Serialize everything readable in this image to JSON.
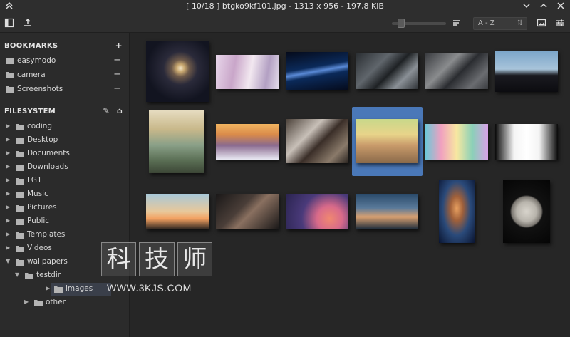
{
  "window": {
    "title": "[ 10/18 ] btgko9kf101.jpg - 1313 x 956 - 197,8 KiB"
  },
  "toolbar": {
    "sort_label": "A - Z",
    "sort_order_icon": "sort-az-icon"
  },
  "bookmarks": {
    "heading": "BOOKMARKS",
    "items": [
      {
        "label": "easymodo"
      },
      {
        "label": "camera"
      },
      {
        "label": "Screenshots"
      }
    ]
  },
  "filesystem": {
    "heading": "FILESYSTEM",
    "items": [
      {
        "label": "coding",
        "expanded": false
      },
      {
        "label": "Desktop",
        "expanded": false
      },
      {
        "label": "Documents",
        "expanded": false
      },
      {
        "label": "Downloads",
        "expanded": false
      },
      {
        "label": "LG1",
        "expanded": false
      },
      {
        "label": "Music",
        "expanded": false
      },
      {
        "label": "Pictures",
        "expanded": false
      },
      {
        "label": "Public",
        "expanded": false
      },
      {
        "label": "Templates",
        "expanded": false
      },
      {
        "label": "Videos",
        "expanded": false
      },
      {
        "label": "wallpapers",
        "expanded": true
      },
      {
        "label": "testdir",
        "expanded": true
      },
      {
        "label": "images",
        "expanded": false,
        "selected": true
      },
      {
        "label": "other",
        "expanded": false
      }
    ]
  },
  "gallery": {
    "selected_index": 10,
    "count": 18
  },
  "watermark": {
    "chars": [
      "科",
      "技",
      "师"
    ],
    "url": "WWW.3KJS.COM"
  },
  "colors": {
    "accent": "#4a78b8",
    "background": "#262626",
    "panel": "#2b2b2b"
  }
}
